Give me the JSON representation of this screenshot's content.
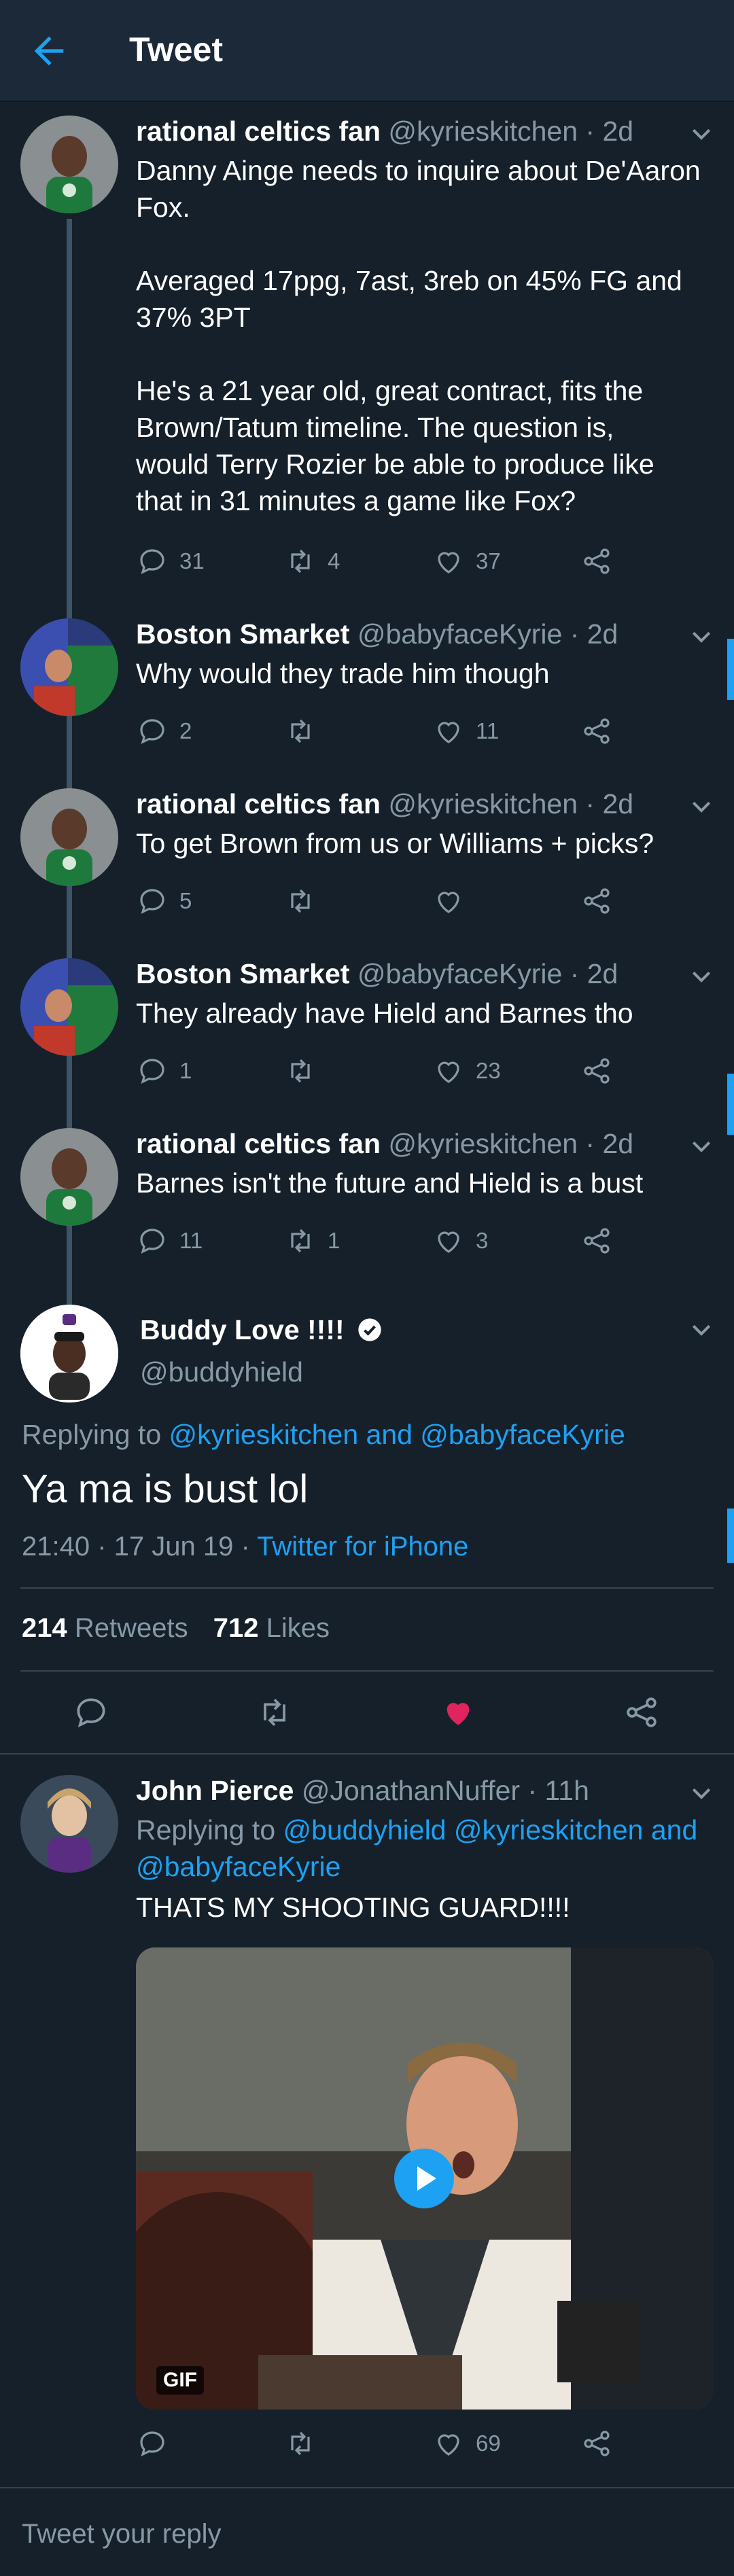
{
  "header": {
    "title": "Tweet"
  },
  "tweets": [
    {
      "name": "rational celtics fan",
      "handle": "@kyrieskitchen",
      "time": "· 2d",
      "lines": [
        "Danny Ainge needs to inquire about De'Aaron",
        "Fox.",
        "",
        "Averaged 17ppg, 7ast, 3reb on 45% FG and",
        "37% 3PT",
        "",
        "He's a 21 year old, great contract, fits the",
        "Brown/Tatum timeline. The question is,",
        "would Terry Rozier be able to produce like",
        "that in 31 minutes a game like Fox?"
      ],
      "replies": "31",
      "retweets": "4",
      "likes": "37"
    },
    {
      "name": "Boston Smarket",
      "handle": "@babyfaceKyrie",
      "time": "· 2d",
      "lines": [
        "Why would they trade him though"
      ],
      "replies": "2",
      "retweets": "",
      "likes": "11"
    },
    {
      "name": "rational celtics fan",
      "handle": "@kyrieskitchen",
      "time": "· 2d",
      "lines": [
        "To get Brown from us or Williams + picks?"
      ],
      "replies": "5",
      "retweets": "",
      "likes": ""
    },
    {
      "name": "Boston Smarket",
      "handle": "@babyfaceKyrie",
      "time": "· 2d",
      "lines": [
        "They already have Hield and Barnes tho"
      ],
      "replies": "1",
      "retweets": "",
      "likes": "23"
    },
    {
      "name": "rational celtics fan",
      "handle": "@kyrieskitchen",
      "time": "· 2d",
      "lines": [
        "Barnes isn't the future and Hield is a bust"
      ],
      "replies": "11",
      "retweets": "1",
      "likes": "3"
    }
  ],
  "main": {
    "name": "Buddy Love !!!!",
    "handle": "@buddyhield",
    "replying_prefix": "Replying to",
    "replying_to": "@kyrieskitchen and @babyfaceKyrie",
    "text": "Ya ma is bust lol",
    "timestamp": "21:40 · 17 Jun 19 ·",
    "source": "Twitter for iPhone",
    "retweets_count": "214",
    "retweets_label": "Retweets",
    "likes_count": "712",
    "likes_label": "Likes"
  },
  "reply": {
    "name": "John Pierce",
    "handle": "@JonathanNuffer",
    "time": "· 11h",
    "replying_prefix": "Replying to",
    "replying_line1": "@buddyhield @kyrieskitchen and",
    "replying_line2": "@babyfaceKyrie",
    "text": "THATS MY SHOOTING GUARD!!!!",
    "gif_badge": "GIF",
    "replies": "",
    "retweets": "",
    "likes": "69"
  },
  "compose": {
    "placeholder": "Tweet your reply"
  },
  "colors": {
    "accent": "#1da1f2",
    "like_active": "#e0245e",
    "background": "#15202b",
    "muted": "#8899a6"
  }
}
